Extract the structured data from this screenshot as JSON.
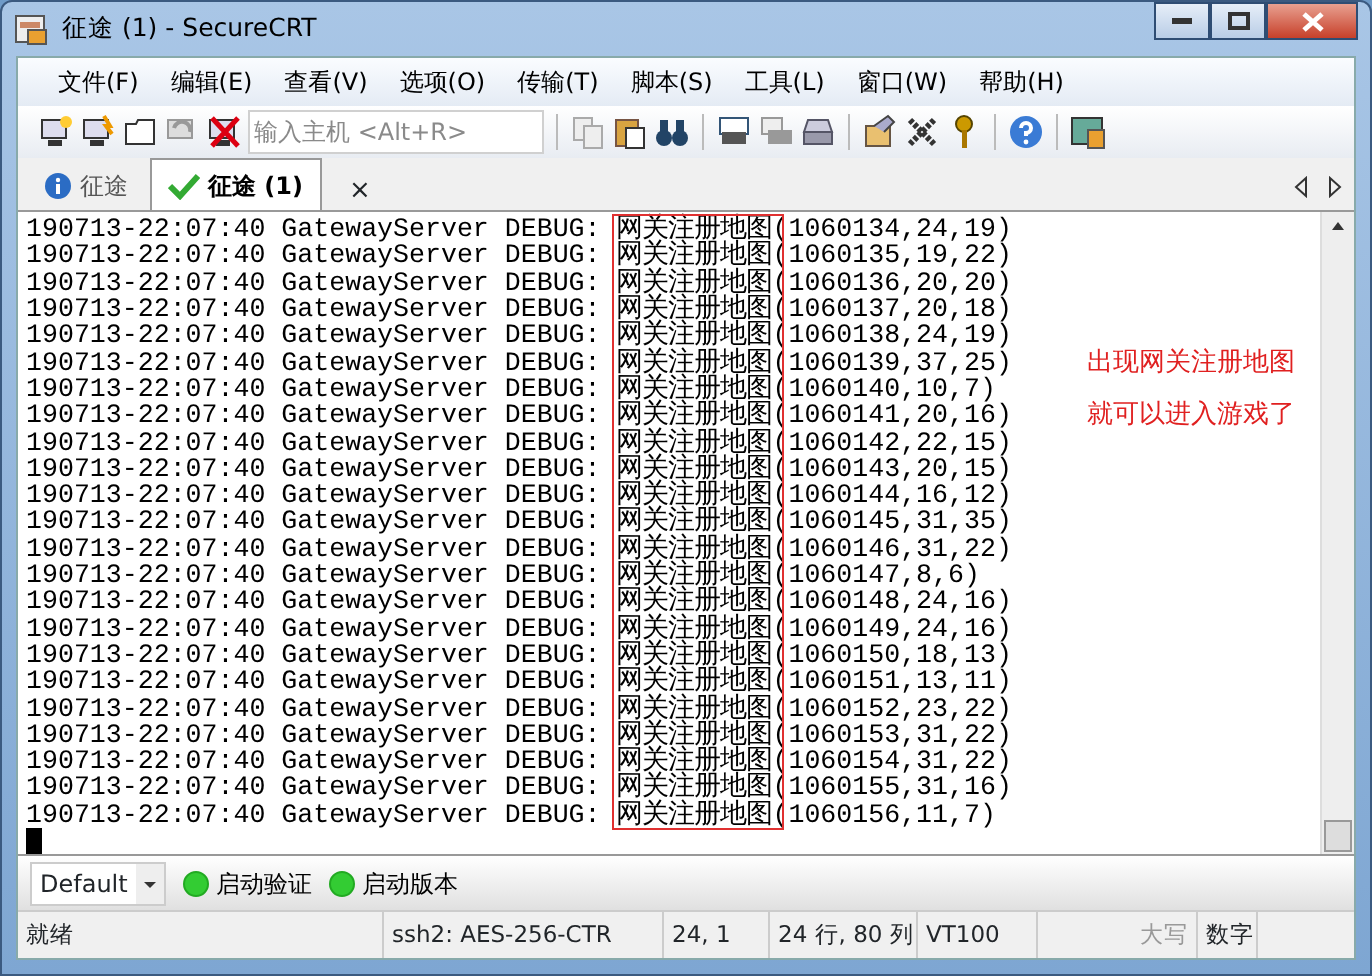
{
  "window": {
    "title": "征途 (1) - SecureCRT"
  },
  "menu": [
    "文件(F)",
    "编辑(E)",
    "查看(V)",
    "选项(O)",
    "传输(T)",
    "脚本(S)",
    "工具(L)",
    "窗口(W)",
    "帮助(H)"
  ],
  "toolbar": {
    "host_field": {
      "placeholder": "输入主机 <Alt+R>"
    }
  },
  "tabs": [
    {
      "label": "征途",
      "selected": false,
      "kind": "info"
    },
    {
      "label": "征途 (1)",
      "selected": true,
      "kind": "connected",
      "close": "×"
    }
  ],
  "terminal": {
    "lines": [
      "190713-22:07:40 GatewayServer DEBUG: 网关注册地图(1060134,24,19)",
      "190713-22:07:40 GatewayServer DEBUG: 网关注册地图(1060135,19,22)",
      "190713-22:07:40 GatewayServer DEBUG: 网关注册地图(1060136,20,20)",
      "190713-22:07:40 GatewayServer DEBUG: 网关注册地图(1060137,20,18)",
      "190713-22:07:40 GatewayServer DEBUG: 网关注册地图(1060138,24,19)",
      "190713-22:07:40 GatewayServer DEBUG: 网关注册地图(1060139,37,25)",
      "190713-22:07:40 GatewayServer DEBUG: 网关注册地图(1060140,10,7)",
      "190713-22:07:40 GatewayServer DEBUG: 网关注册地图(1060141,20,16)",
      "190713-22:07:40 GatewayServer DEBUG: 网关注册地图(1060142,22,15)",
      "190713-22:07:40 GatewayServer DEBUG: 网关注册地图(1060143,20,15)",
      "190713-22:07:40 GatewayServer DEBUG: 网关注册地图(1060144,16,12)",
      "190713-22:07:40 GatewayServer DEBUG: 网关注册地图(1060145,31,35)",
      "190713-22:07:40 GatewayServer DEBUG: 网关注册地图(1060146,31,22)",
      "190713-22:07:40 GatewayServer DEBUG: 网关注册地图(1060147,8,6)",
      "190713-22:07:40 GatewayServer DEBUG: 网关注册地图(1060148,24,16)",
      "190713-22:07:40 GatewayServer DEBUG: 网关注册地图(1060149,24,16)",
      "190713-22:07:40 GatewayServer DEBUG: 网关注册地图(1060150,18,13)",
      "190713-22:07:40 GatewayServer DEBUG: 网关注册地图(1060151,13,11)",
      "190713-22:07:40 GatewayServer DEBUG: 网关注册地图(1060152,23,22)",
      "190713-22:07:40 GatewayServer DEBUG: 网关注册地图(1060153,31,22)",
      "190713-22:07:40 GatewayServer DEBUG: 网关注册地图(1060154,31,22)",
      "190713-22:07:40 GatewayServer DEBUG: 网关注册地图(1060155,31,16)",
      "190713-22:07:40 GatewayServer DEBUG: 网关注册地图(1060156,11,7)"
    ],
    "notes": [
      "出现网关注册地图",
      "就可以进入游戏了"
    ]
  },
  "button_bar": {
    "dropdown": "Default",
    "buttons": [
      "启动验证",
      "启动版本"
    ]
  },
  "status_bar": [
    {
      "text": "就绪",
      "disabled": false
    },
    {
      "text": "ssh2: AES-256-CTR",
      "disabled": false
    },
    {
      "text": "24,   1",
      "disabled": false
    },
    {
      "text": "24 行, 80 列",
      "disabled": false
    },
    {
      "text": "VT100",
      "disabled": false
    },
    {
      "text": "大写",
      "disabled": true
    },
    {
      "text": "数字",
      "disabled": false
    }
  ]
}
